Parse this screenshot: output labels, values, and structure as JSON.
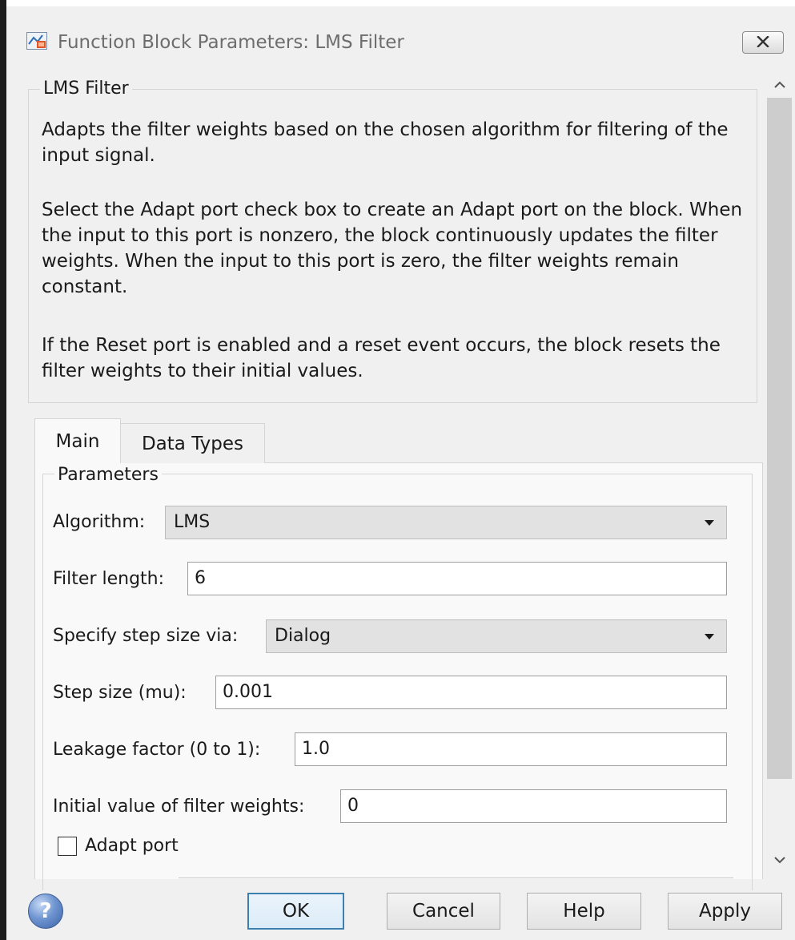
{
  "window": {
    "title": "Function Block Parameters: LMS Filter",
    "close_icon": "close-x-icon",
    "app_icon": "simulink-block-icon"
  },
  "description": {
    "group_title": "LMS Filter",
    "paragraphs": [
      "Adapts the filter weights based on the chosen algorithm for filtering of the input signal.",
      "Select the Adapt port check box to create an Adapt port on the block. When the input to this port is nonzero, the block continuously updates the filter weights. When the input to this port is zero, the filter weights remain constant.",
      "If the Reset port is enabled and a reset event occurs, the block resets the filter weights to their initial values."
    ]
  },
  "tabs": [
    {
      "label": "Main",
      "active": true
    },
    {
      "label": "Data Types",
      "active": false
    }
  ],
  "parameters": {
    "group_title": "Parameters",
    "algorithm": {
      "label": "Algorithm:",
      "value": "LMS"
    },
    "filter_length": {
      "label": "Filter length:",
      "value": "6"
    },
    "step_size_via": {
      "label": "Specify step size via:",
      "value": "Dialog"
    },
    "step_size": {
      "label": "Step size (mu):",
      "value": "0.001"
    },
    "leakage_factor": {
      "label": "Leakage factor (0 to 1):",
      "value": "1.0"
    },
    "initial_weights": {
      "label": "Initial value of filter weights:",
      "value": "0"
    },
    "adapt_port": {
      "label": "Adapt port",
      "checked": false
    }
  },
  "buttons": {
    "help_icon": "?",
    "ok": "OK",
    "cancel": "Cancel",
    "help": "Help",
    "apply": "Apply"
  },
  "colors": {
    "dialog_background": "#f0f0f0",
    "panel_background": "#f9f9f9",
    "default_button_border": "#3c7fb1"
  }
}
